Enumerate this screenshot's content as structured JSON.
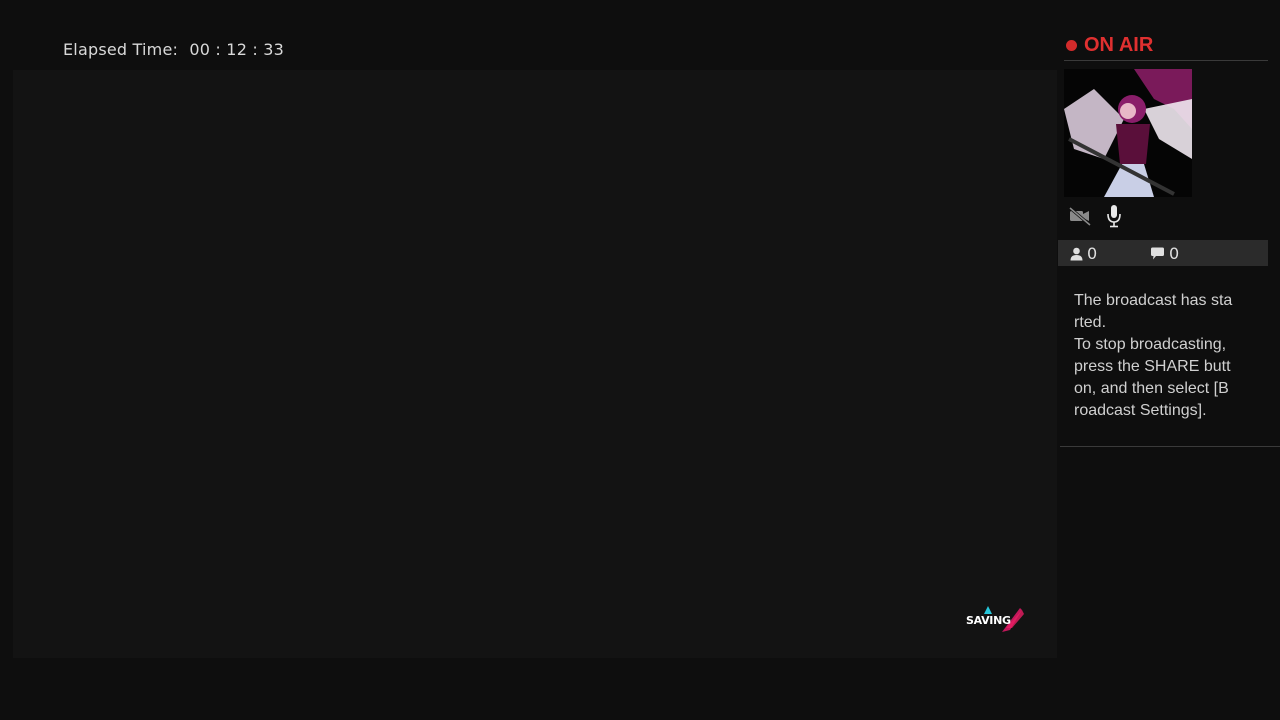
{
  "elapsed": {
    "label": "Elapsed Time",
    "separator": ":",
    "value": "00 : 12 : 33"
  },
  "overlay": {
    "saving_text": "SAVING"
  },
  "panel": {
    "status_label": "ON AIR",
    "status_color": "#e03030",
    "viewers_count": "0",
    "comments_count": "0",
    "message_line1": "The broadcast has started.",
    "message_line2": "To stop broadcasting, press the SHARE button, and then select [Broadcast Settings]."
  },
  "icons": {
    "camera": "camera-off-icon",
    "microphone": "microphone-icon",
    "viewers": "person-icon",
    "comments": "speech-bubble-icon"
  }
}
